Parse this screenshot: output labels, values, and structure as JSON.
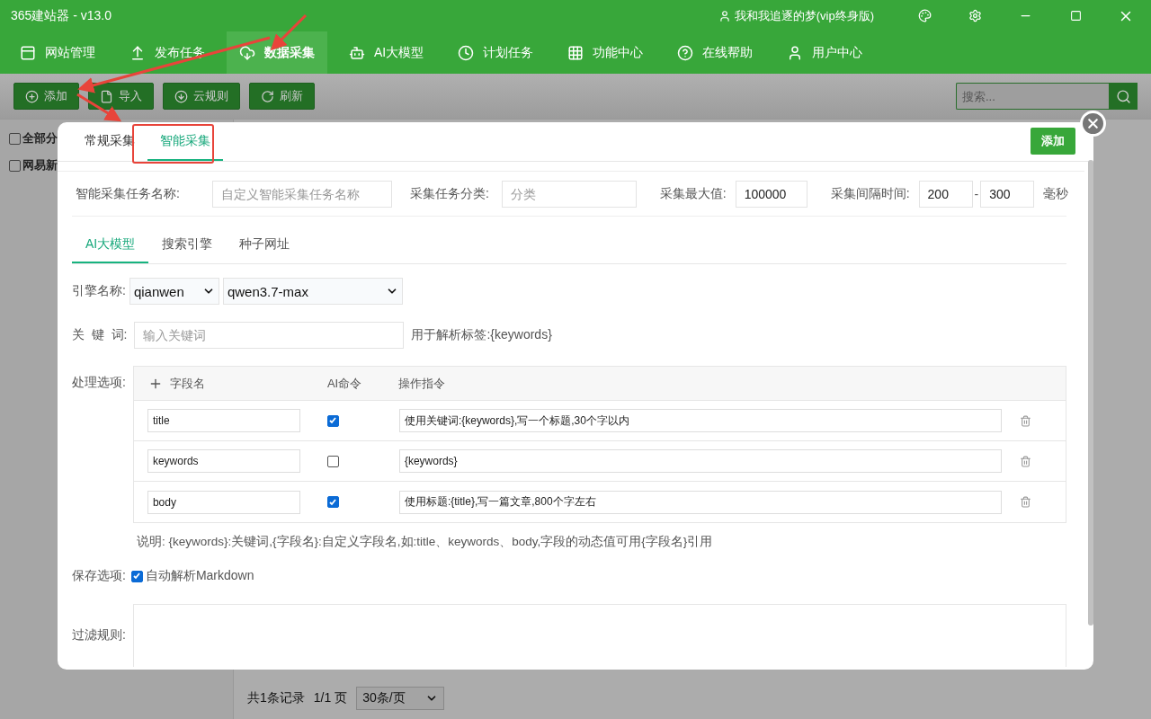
{
  "window": {
    "title": "365建站器 - v13.0",
    "user": "我和我追逐的梦(vip终身版)"
  },
  "nav": [
    {
      "label": "网站管理",
      "selected": false
    },
    {
      "label": "发布任务",
      "selected": false
    },
    {
      "label": "数据采集",
      "selected": true
    },
    {
      "label": "AI大模型",
      "selected": false
    },
    {
      "label": "计划任务",
      "selected": false
    },
    {
      "label": "功能中心",
      "selected": false
    },
    {
      "label": "在线帮助",
      "selected": false
    },
    {
      "label": "用户中心",
      "selected": false
    }
  ],
  "toolbar": {
    "buttons": [
      "添加",
      "导入",
      "云规则",
      "刷新"
    ],
    "search": {
      "placeholder": "搜索..."
    }
  },
  "sidebar": {
    "items": [
      {
        "label": "全部分",
        "checked": false
      },
      {
        "label": "网易新",
        "checked": false
      }
    ]
  },
  "pagination": {
    "summary": "共1条记录",
    "pages": "1/1 页",
    "page_size": "30条/页"
  },
  "dialog": {
    "tabs": [
      {
        "label": "常规采集",
        "selected": false
      },
      {
        "label": "智能采集",
        "selected": true
      }
    ],
    "add_button": "添加",
    "task": {
      "name_label": "智能采集任务名称:",
      "name_placeholder": "自定义智能采集任务名称",
      "category_label": "采集任务分类:",
      "category_placeholder": "分类",
      "max_label": "采集最大值:",
      "max_value": "100000",
      "interval_label": "采集间隔时间:",
      "interval_min": "200",
      "interval_sep": "-",
      "interval_max": "300",
      "interval_unit": "毫秒"
    },
    "sub_tabs": [
      {
        "label": "AI大模型",
        "selected": true
      },
      {
        "label": "搜索引擎",
        "selected": false
      },
      {
        "label": "种子网址",
        "selected": false
      }
    ],
    "engine": {
      "label": "引擎名称:",
      "provider": "qianwen",
      "model": "qwen3.7-max"
    },
    "keyword": {
      "label": "关  键  词:",
      "placeholder": "输入关键词",
      "hint": "用于解析标签:{keywords}"
    },
    "options": {
      "label": "处理选项:",
      "columns": [
        "字段名",
        "AI命令",
        "操作指令"
      ],
      "rows": [
        {
          "field": "title",
          "ai": true,
          "instruction": "使用关键词:{keywords},写一个标题,30个字以内"
        },
        {
          "field": "keywords",
          "ai": false,
          "instruction": "{keywords}"
        },
        {
          "field": "body",
          "ai": true,
          "instruction": "使用标题:{title},写一篇文章,800个字左右"
        }
      ],
      "note": "说明:   {keywords}:关键词,{字段名}:自定义字段名,如:title、keywords、body,字段的动态值可用{字段名}引用"
    },
    "save": {
      "label": "保存选项:",
      "option": "自动解析Markdown",
      "checked": true
    },
    "filter": {
      "label": "过滤规则:"
    }
  }
}
